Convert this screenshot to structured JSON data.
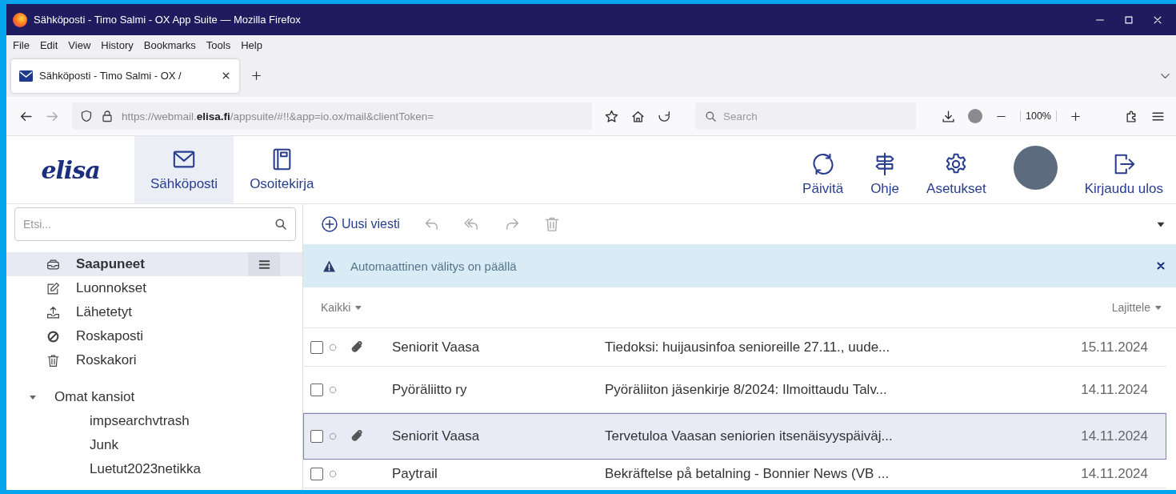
{
  "window": {
    "title": "Sähköposti - Timo Salmi - OX App Suite — Mozilla Firefox"
  },
  "menu_bar": [
    "File",
    "Edit",
    "View",
    "History",
    "Bookmarks",
    "Tools",
    "Help"
  ],
  "browser_tabs": [
    {
      "label": "Sähköposti - Timo Salmi - OX /",
      "selected": true
    }
  ],
  "address_bar": {
    "url": "https://webmail.**elisa.fi**/appsuite/#!!&app=io.ox/mail&clientToken="
  },
  "browser_search": {
    "placeholder": "Search"
  },
  "zoom": "100%",
  "app_header": {
    "logo": "elisa",
    "nav": [
      {
        "label": "Sähköposti",
        "selected": true
      },
      {
        "label": "Osoitekirja",
        "selected": false
      }
    ],
    "actions": [
      {
        "kind": "button",
        "label": "Päivitä"
      },
      {
        "kind": "button",
        "label": "Ohje"
      },
      {
        "kind": "button",
        "label": "Asetukset"
      },
      {
        "kind": "avatar"
      },
      {
        "kind": "button",
        "label": "Kirjaudu ulos"
      }
    ]
  },
  "sidebar": {
    "search": {
      "placeholder": "Etsi..."
    },
    "folders": [
      {
        "label": "Saapuneet",
        "selected": true
      },
      {
        "label": "Luonnokset",
        "selected": false
      },
      {
        "label": "Lähetetyt",
        "selected": false
      },
      {
        "label": "Roskaposti",
        "selected": false
      },
      {
        "label": "Roskakori",
        "selected": false
      }
    ],
    "section": {
      "label": "Omat kansiot",
      "expanded": true,
      "children": [
        {
          "label": "impsearchvtrash"
        },
        {
          "label": "Junk"
        },
        {
          "label": "Luetut2023netikka"
        }
      ]
    }
  },
  "toolbar": [
    {
      "label": "Uusi viesti",
      "disabled": false
    },
    {
      "disabled": true
    },
    {
      "disabled": true
    },
    {
      "disabled": true
    },
    {
      "disabled": true
    }
  ],
  "banner": {
    "text": "Automaattinen välitys on päällä"
  },
  "list": {
    "filter": "Kaikki",
    "sort": "Lajittele",
    "messages": [
      {
        "checked": false,
        "attachment": true,
        "from": "Seniorit Vaasa",
        "subject": "Tiedoksi: huijausinfoa senioreille 27.11., uude...",
        "date": "15.11.2024",
        "selected": false
      },
      {
        "checked": false,
        "attachment": false,
        "from": "Pyöräliitto ry",
        "subject": "Pyöräliiton jäsenkirje 8/2024: Ilmoittaudu Talv...",
        "date": "14.11.2024",
        "selected": false
      },
      {
        "checked": false,
        "attachment": true,
        "from": "Seniorit Vaasa",
        "subject": "Tervetuloa Vaasan seniorien itsenäisyyspäiväj...",
        "date": "14.11.2024",
        "selected": true
      },
      {
        "checked": false,
        "attachment": false,
        "from": "Paytrail",
        "subject": "Bekräftelse på betalning - Bonnier News (VB ...",
        "date": "14.11.2024",
        "selected": false
      }
    ]
  }
}
